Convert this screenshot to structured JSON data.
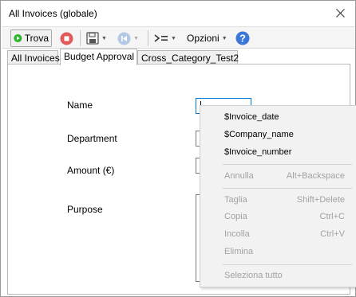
{
  "window": {
    "title": "All Invoices (globale)"
  },
  "toolbar": {
    "find_label": "Trova",
    "options_label": "Opzioni",
    "colors": {
      "play": "#2db52d",
      "stop": "#e05a5a",
      "help": "#3a77d8",
      "nav_disabled": "#b4c9e6"
    }
  },
  "tabs": [
    "All Invoices",
    "Budget Approval",
    "Cross_Category_Test2"
  ],
  "form": {
    "name_label": "Name",
    "department_label": "Department",
    "amount_label": "Amount (€)",
    "purpose_label": "Purpose"
  },
  "context_menu": {
    "var_invoice_date": "$Invoice_date",
    "var_company_name": "$Company_name",
    "var_invoice_number": "$Invoice_number",
    "undo": "Annulla",
    "undo_shortcut": "Alt+Backspace",
    "cut": "Taglia",
    "cut_shortcut": "Shift+Delete",
    "copy": "Copia",
    "copy_shortcut": "Ctrl+C",
    "paste": "Incolla",
    "paste_shortcut": "Ctrl+V",
    "delete": "Elimina",
    "select_all": "Seleziona tutto"
  }
}
